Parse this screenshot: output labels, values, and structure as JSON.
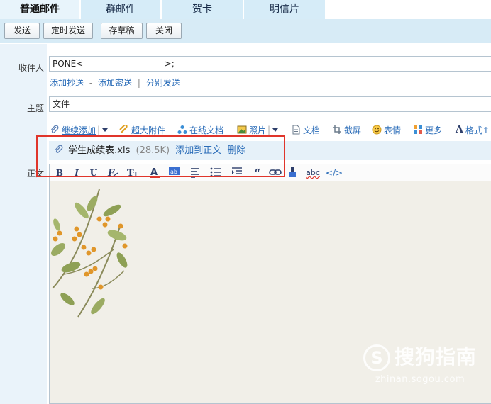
{
  "tabs": [
    "普通邮件",
    "群邮件",
    "贺卡",
    "明信片"
  ],
  "actions": {
    "send": "发送",
    "scheduled": "定时发送",
    "draft": "存草稿",
    "close": "关闭"
  },
  "recipient": {
    "label": "收件人",
    "value": "PONE<                              >;"
  },
  "recipient_links": {
    "cc": "添加抄送",
    "bcc": "添加密送",
    "separate": "分别发送",
    "dash": "-",
    "bar": "|"
  },
  "subject": {
    "label": "主题",
    "value": "文件"
  },
  "attach_toolbar": {
    "continue_add": "继续添加",
    "large_attach": "超大附件",
    "online_doc": "在线文档",
    "photo": "照片",
    "doc": "文档",
    "screenshot": "截屏",
    "emoji": "表情",
    "more": "更多",
    "format": "格式↑"
  },
  "attachment": {
    "filename": "学生成绩表.xls",
    "size": "(28.5K)",
    "add_to_body": "添加到正文",
    "delete": "删除"
  },
  "body": {
    "label": "正文"
  },
  "format_toolbar": {
    "bold": "B",
    "italic": "I",
    "underline": "U",
    "spell": "abc",
    "source": "</>"
  },
  "watermark": {
    "logo": "S",
    "title": "搜狗指南",
    "url": "zhinan.sogou.com"
  },
  "colors": {
    "accent_link": "#2a6cb8",
    "toolbar_bg": "#d7ebf6",
    "highlight": "#e0352b"
  }
}
